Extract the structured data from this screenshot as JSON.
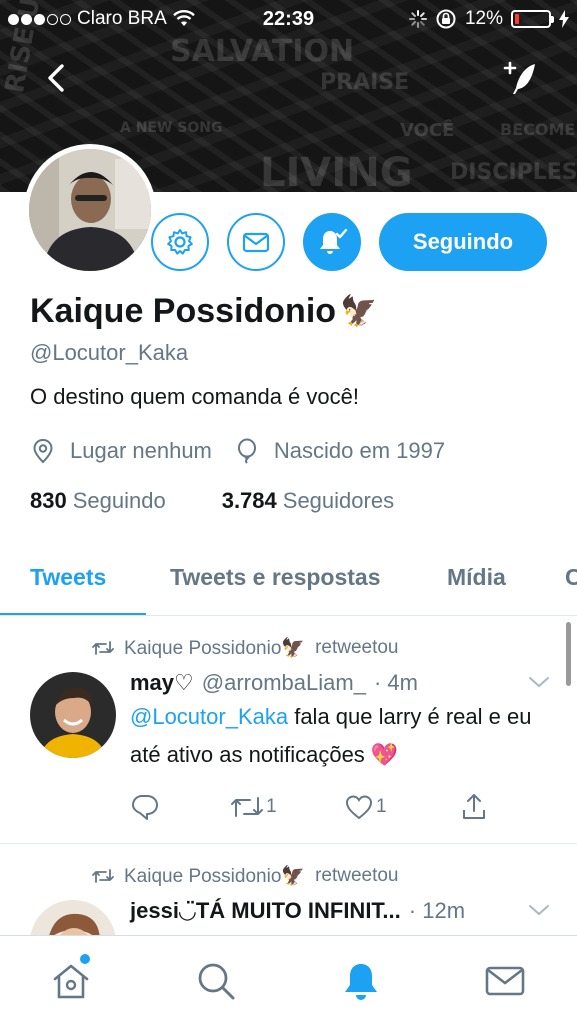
{
  "status_bar": {
    "carrier": "Claro BRA",
    "time": "22:39",
    "battery_percent": "12%",
    "battery_level": 0.12,
    "signal_bars_filled": 3,
    "signal_bars_total": 5
  },
  "banner": {
    "words": [
      "SALVATION",
      "RISE UP",
      "LIVING",
      "DISCIPLES",
      "A NEW SONG",
      "PRAISE",
      "VOCÊ",
      "BECOME"
    ]
  },
  "profile": {
    "name": "Kaique Possidonio",
    "name_emoji": "🦅",
    "handle": "@Locutor_Kaka",
    "bio": "O destino quem comanda é você!",
    "location": "Lugar nenhum",
    "birth": "Nascido em 1997",
    "following_count": "830",
    "following_label": "Seguindo",
    "followers_count": "3.784",
    "followers_label": "Seguidores",
    "follow_button": "Seguindo"
  },
  "tabs": [
    {
      "label": "Tweets",
      "active": true
    },
    {
      "label": "Tweets e respostas",
      "active": false
    },
    {
      "label": "Mídia",
      "active": false
    },
    {
      "label": "Curtidas",
      "active": false
    }
  ],
  "tweets": [
    {
      "retweeted_by": "Kaique Possidonio🦅",
      "retweet_label": "retweetou",
      "author_name": "may♡",
      "author_handle": "@arrombaLiam_",
      "time": "· 4m",
      "mention": "@Locutor_Kaka",
      "text": " fala que larry é real e eu até ativo as notificações 💖",
      "retweets": "1",
      "likes": "1"
    },
    {
      "retweeted_by": "Kaique Possidonio🦅",
      "retweet_label": "retweetou",
      "author_name": "jessi◡̈TÁ MUITO INFINIT...",
      "time": "· 12m"
    }
  ],
  "colors": {
    "accent": "#1da1f2",
    "secondary_text": "#657786",
    "battery_low": "#ff3b30"
  }
}
